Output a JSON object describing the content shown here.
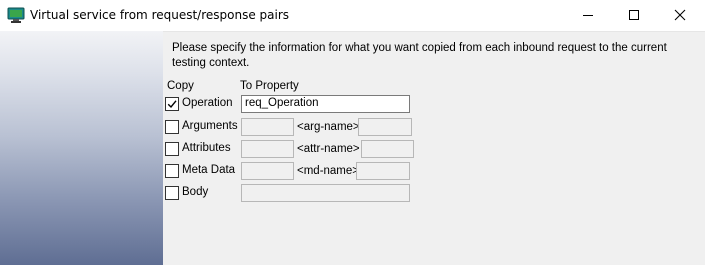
{
  "window": {
    "title": "Virtual service from request/response pairs",
    "icon": "monitor-app-icon",
    "controls": [
      "minimize-icon",
      "maximize-icon",
      "close-icon"
    ]
  },
  "main": {
    "instructions": "Please specify the information for what you want copied from each inbound request to the current testing context.",
    "headers": {
      "copy": "Copy",
      "to_property": "To Property"
    },
    "rows": [
      {
        "label": "Operation",
        "checked": true,
        "value": "req_Operation"
      },
      {
        "label": "Arguments",
        "checked": false,
        "name_label": "<arg-name>"
      },
      {
        "label": "Attributes",
        "checked": false,
        "name_label": "<attr-name>"
      },
      {
        "label": "Meta Data",
        "checked": false,
        "name_label": "<md-name>"
      },
      {
        "label": "Body",
        "checked": false
      }
    ]
  },
  "colors": {
    "panel_gradient_top": "#f2f3f6",
    "panel_gradient_bottom": "#5f6e93",
    "icon_teal": "#1b8a8a",
    "icon_green": "#3aa64a"
  }
}
